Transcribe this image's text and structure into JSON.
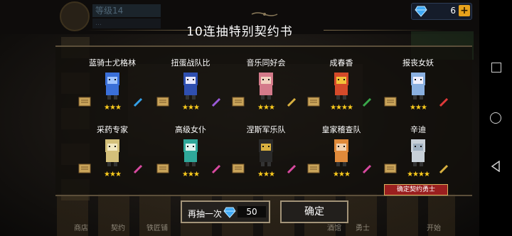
{
  "header": {
    "player_level": "等级14",
    "player_sub": "…",
    "gems": "6",
    "plus": "+"
  },
  "dialog": {
    "title": "10连抽特别契约书",
    "cards": [
      {
        "name": "蓝骑士尤格林",
        "stars": "★★★"
      },
      {
        "name": "扭蛋战队比",
        "stars": "★★★"
      },
      {
        "name": "音乐同好会",
        "stars": "★★★"
      },
      {
        "name": "成春香",
        "stars": "★★★★"
      },
      {
        "name": "报丧女妖",
        "stars": "★★★"
      },
      {
        "name": "采药专家",
        "stars": "★★★"
      },
      {
        "name": "高级女仆",
        "stars": "★★★"
      },
      {
        "name": "涅斯军乐队",
        "stars": "★★★"
      },
      {
        "name": "皇家稽查队",
        "stars": "★★★"
      },
      {
        "name": "辛迪",
        "stars": "★★★★"
      }
    ],
    "confirm_tag": "确定契约勇士",
    "redraw_label": "再抽一次",
    "redraw_cost": "50",
    "ok_label": "确定"
  },
  "bottom_nav": [
    "商店",
    "契约",
    "铁匠铺",
    "酒馆",
    "勇士",
    "开始"
  ],
  "colors": {
    "star": "#ffcc1d",
    "tag_red": "#9a1f1f",
    "button_border": "#a39479",
    "gem_blue": "#3fa9f5"
  },
  "icons": {
    "gem": "diamond-icon",
    "book": "book-icon",
    "sys_square": "recents-icon",
    "sys_circle": "home-icon",
    "sys_back": "back-icon"
  }
}
